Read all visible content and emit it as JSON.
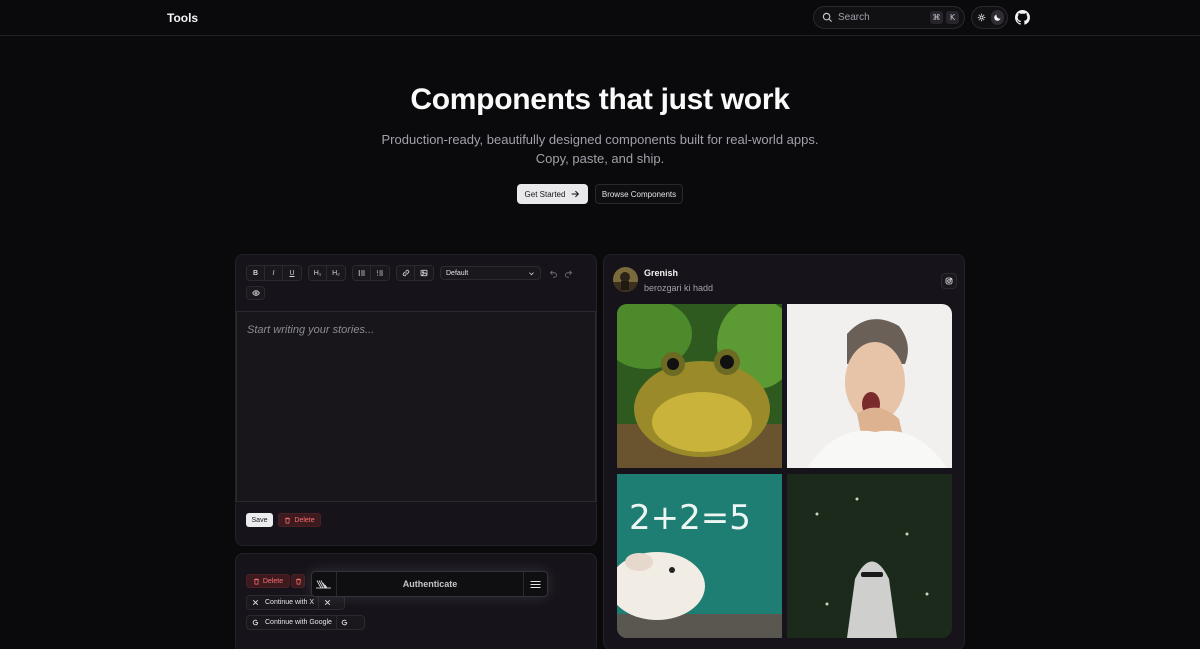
{
  "header": {
    "brand": "Tools",
    "search_placeholder": "Search",
    "shortcut_keys": [
      "⌘",
      "K"
    ],
    "icons": [
      "search-icon",
      "sun-icon",
      "moon-icon",
      "github-icon"
    ]
  },
  "hero": {
    "title": "Components that just work",
    "subtitle_line1": "Production-ready, beautifully designed components built for real-world apps.",
    "subtitle_line2": "Copy, paste, and ship.",
    "primary_cta": "Get Started",
    "secondary_cta": "Browse Components"
  },
  "editor": {
    "toolbar": {
      "bold": "B",
      "italic": "I",
      "underline": "U",
      "h1": "H₁",
      "h2": "H₂",
      "style_select": "Default"
    },
    "placeholder": "Start writing your stories...",
    "save_label": "Save",
    "delete_label": "Delete"
  },
  "auth": {
    "delete_label": "Delete",
    "popover_title": "Authenticate",
    "continue_x": "Continue with X",
    "continue_google": "Continue with Google"
  },
  "social": {
    "name": "Grenish",
    "handle": "berozgari ki hadd",
    "photo_equation": "2+2=5"
  },
  "colors": {
    "background": "#0a090b",
    "card": "#16141a",
    "danger": "#f87171",
    "primary_button": "#e9e9ec"
  }
}
